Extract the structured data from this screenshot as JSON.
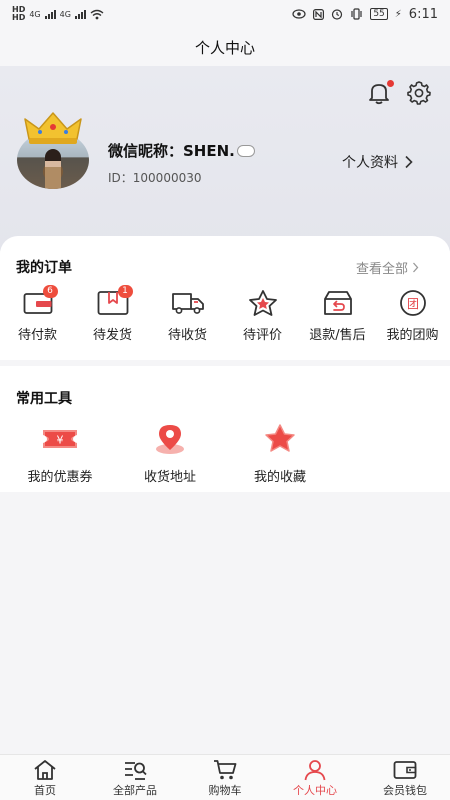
{
  "status_bar": {
    "time": "6:11",
    "battery": "55",
    "network1": "4G",
    "network2": "4G"
  },
  "title": "个人中心",
  "profile": {
    "nickname": "微信昵称：SHEN.",
    "user_id": "ID：100000030",
    "profile_link": "个人资料"
  },
  "orders": {
    "title": "我的订单",
    "view_all": "查看全部",
    "items": [
      {
        "label": "待付款",
        "badge": "6",
        "icon": "wallet-icon"
      },
      {
        "label": "待发货",
        "badge": "1",
        "icon": "box-bookmark-icon"
      },
      {
        "label": "待收货",
        "icon": "truck-icon"
      },
      {
        "label": "待评价",
        "icon": "star-icon"
      },
      {
        "label": "退款/售后",
        "icon": "return-box-icon"
      },
      {
        "label": "我的团购",
        "icon": "group-icon"
      }
    ]
  },
  "tools": {
    "title": "常用工具",
    "items": [
      {
        "label": "我的优惠券",
        "icon": "coupon-icon"
      },
      {
        "label": "收货地址",
        "icon": "location-icon"
      },
      {
        "label": "我的收藏",
        "icon": "favorite-star-icon"
      }
    ]
  },
  "bottom_nav": {
    "active": "个人中心",
    "items": [
      {
        "label": "首页",
        "icon": "home-icon"
      },
      {
        "label": "全部产品",
        "icon": "search-list-icon"
      },
      {
        "label": "购物车",
        "icon": "cart-icon"
      },
      {
        "label": "个人中心",
        "icon": "person-icon"
      },
      {
        "label": "会员钱包",
        "icon": "wallet-icon"
      }
    ]
  },
  "colors": {
    "accent": "#e5484d",
    "badge": "#ee4d3d",
    "header_bg": "#e6e7ee"
  }
}
